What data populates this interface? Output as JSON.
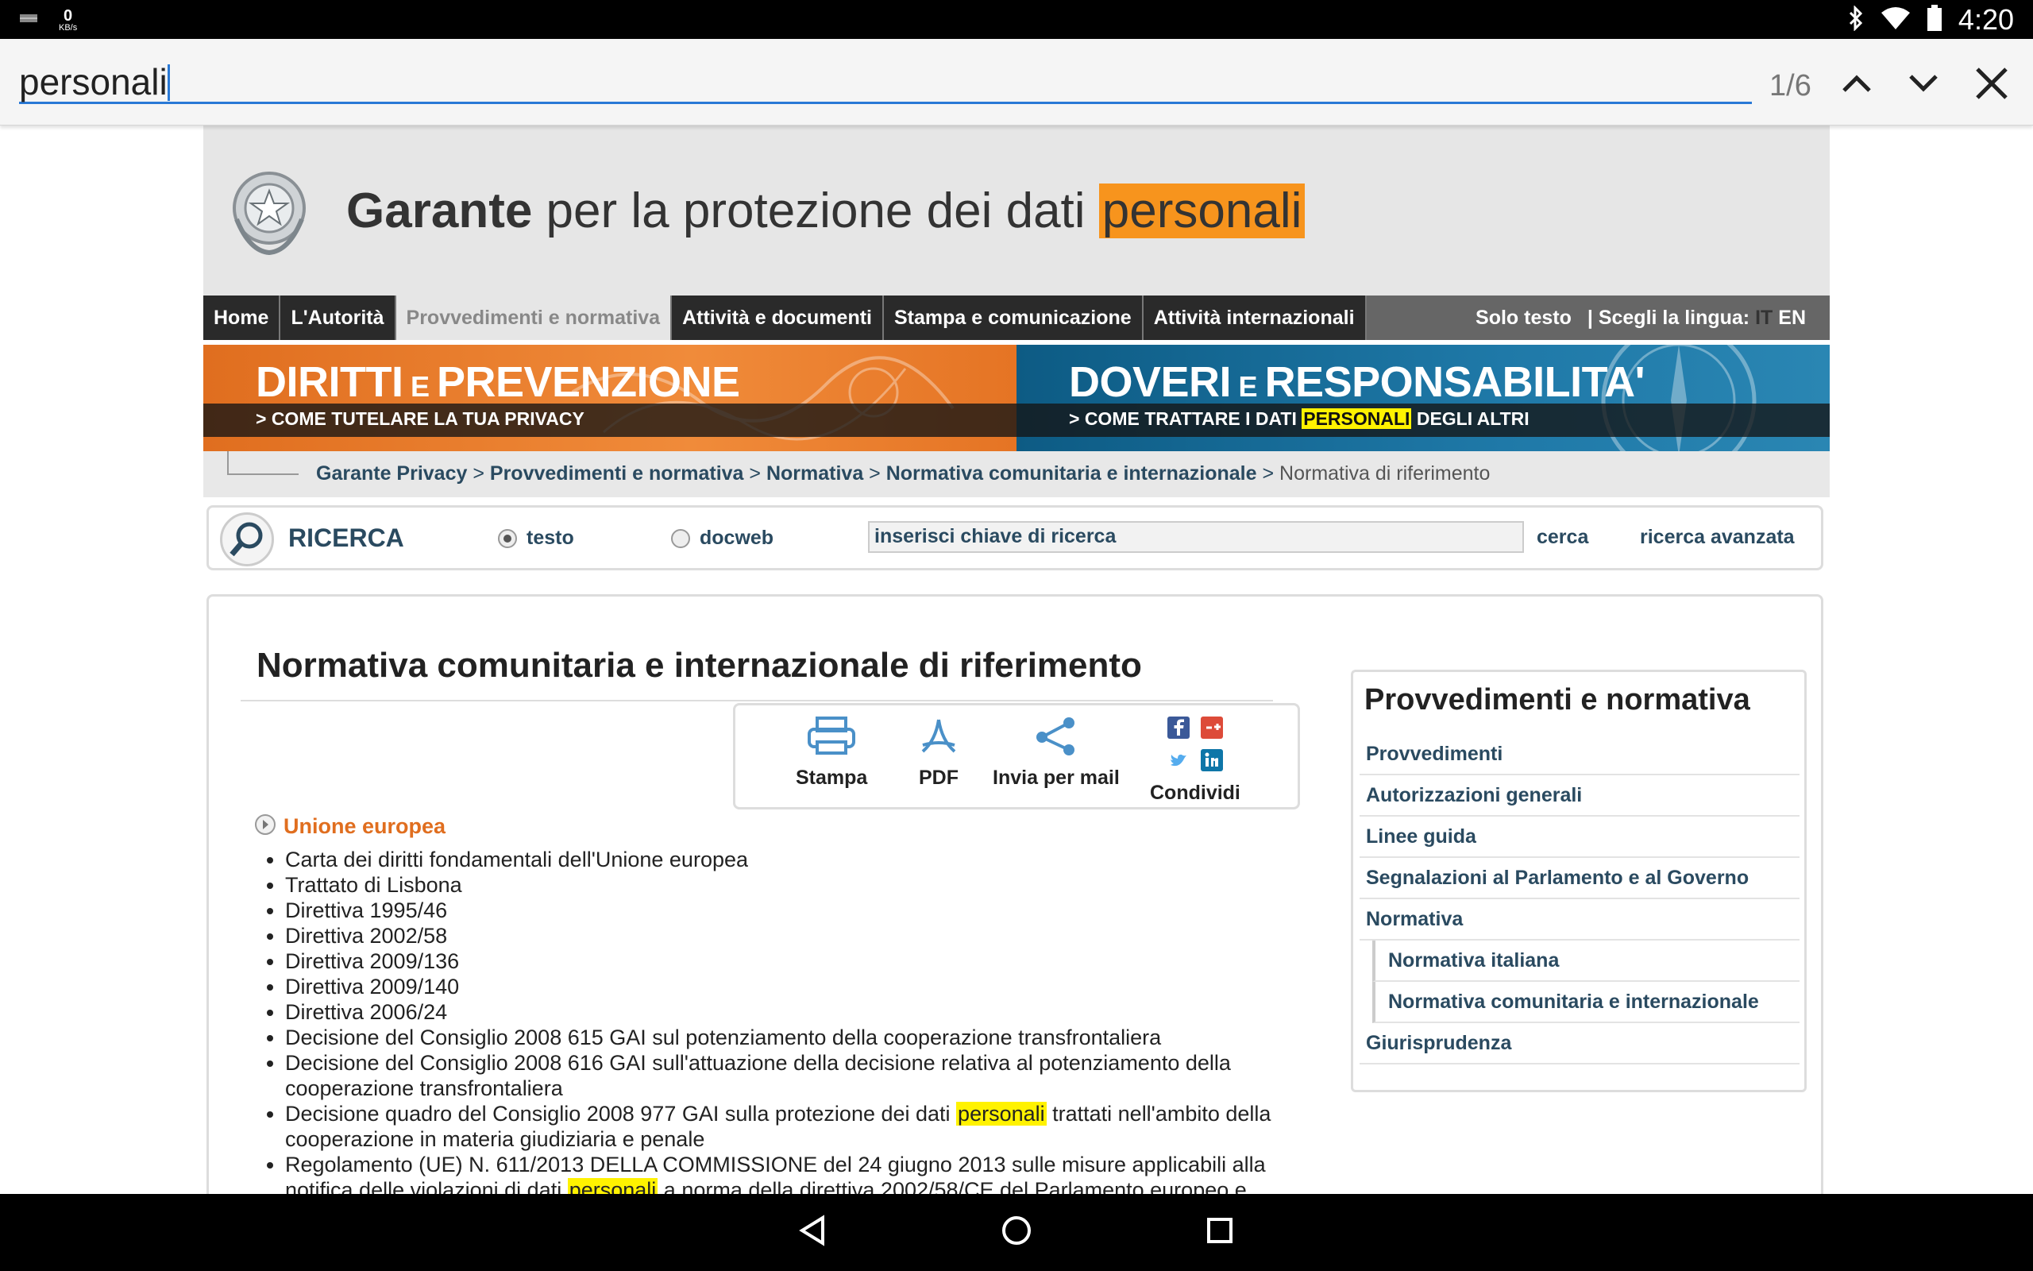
{
  "status_bar": {
    "net_speed_value": "0",
    "net_speed_unit": "KB/s",
    "time": "4:20"
  },
  "find_bar": {
    "query": "personali",
    "match_count": "1/6"
  },
  "site": {
    "title_bold": "Garante",
    "title_mid": " per la protezione dei dati ",
    "title_highlight": "personali"
  },
  "nav": {
    "items": [
      "Home",
      "L'Autorità",
      "Provvedimenti e normativa",
      "Attività e documenti",
      "Stampa e comunicazione",
      "Attività internazionali"
    ],
    "solo_testo": "Solo testo",
    "lingua_label": "| Scegli la lingua:",
    "lang_it": "IT",
    "lang_en": "EN"
  },
  "banners": {
    "left_title_a": "DIRITTI",
    "left_title_e": " E ",
    "left_title_b": "PREVENZIONE",
    "left_sub": "> COME TUTELARE LA TUA PRIVACY",
    "right_title_a": "DOVERI",
    "right_title_e": " E ",
    "right_title_b": "RESPONSABILITA'",
    "right_sub_a": "> COME TRATTARE I DATI ",
    "right_sub_hl": "PERSONALI",
    "right_sub_b": " DEGLI ALTRI"
  },
  "breadcrumb": {
    "items": [
      "Garante Privacy",
      "Provvedimenti e normativa",
      "Normativa",
      "Normativa comunitaria e internazionale"
    ],
    "sep": " > ",
    "current": "Normativa di riferimento"
  },
  "search": {
    "label": "RICERCA",
    "radio_testo": "testo",
    "radio_docweb": "docweb",
    "placeholder": "inserisci chiave di ricerca",
    "submit": "cerca",
    "advanced": "ricerca avanzata"
  },
  "content": {
    "title": "Normativa comunitaria e internazionale di riferimento",
    "share": {
      "stampa": "Stampa",
      "pdf": "PDF",
      "mail": "Invia per mail",
      "condividi": "Condividi"
    },
    "section_title": "Unione europea",
    "items_simple": [
      "Carta dei diritti fondamentali dell'Unione europea",
      "Trattato di Lisbona",
      "Direttiva 1995/46",
      "Direttiva 2002/58",
      "Direttiva 2009/136",
      "Direttiva 2009/140",
      "Direttiva 2006/24",
      "Decisione del Consiglio 2008 615 GAI sul potenziamento della cooperazione transfrontaliera",
      "Decisione del Consiglio 2008 616 GAI sull'attuazione della decisione relativa al potenziamento della cooperazione transfrontaliera"
    ],
    "item_977_a": "Decisione quadro del Consiglio 2008 977 GAI sulla protezione dei dati ",
    "item_977_hl": "personali",
    "item_977_b": " trattati nell'ambito della cooperazione in materia giudiziaria e penale",
    "item_611_a": "Regolamento (UE) N. 611/2013 DELLA COMMISSIONE del 24 giugno 2013 sulle misure applicabili alla notifica delle violazioni di dati ",
    "item_611_hl": "personali",
    "item_611_b": " a norma della direttiva 2002/58/CE del Parlamento europeo e"
  },
  "sidebar": {
    "title": "Provvedimenti e normativa",
    "items": [
      "Provvedimenti",
      "Autorizzazioni generali",
      "Linee guida",
      "Segnalazioni al Parlamento e al Governo",
      "Normativa"
    ],
    "subitems": [
      "Normativa italiana",
      "Normativa comunitaria e internazionale"
    ],
    "last_item": "Giurisprudenza"
  },
  "colors": {
    "accent_orange": "#e06e1f",
    "accent_blue": "#1f79a8",
    "find_underline": "#2979d6",
    "match_highlight": "#fff200",
    "active_match": "#f7941d"
  },
  "icons": [
    "battery-saver-icon",
    "bluetooth-icon",
    "wifi-icon",
    "battery-icon",
    "chevron-up-icon",
    "chevron-down-icon",
    "close-icon",
    "emblem-icon",
    "search-icon",
    "print-icon",
    "pdf-icon",
    "share-icon",
    "facebook-icon",
    "google-plus-icon",
    "twitter-icon",
    "linkedin-icon",
    "back-icon",
    "home-icon",
    "recents-icon"
  ]
}
